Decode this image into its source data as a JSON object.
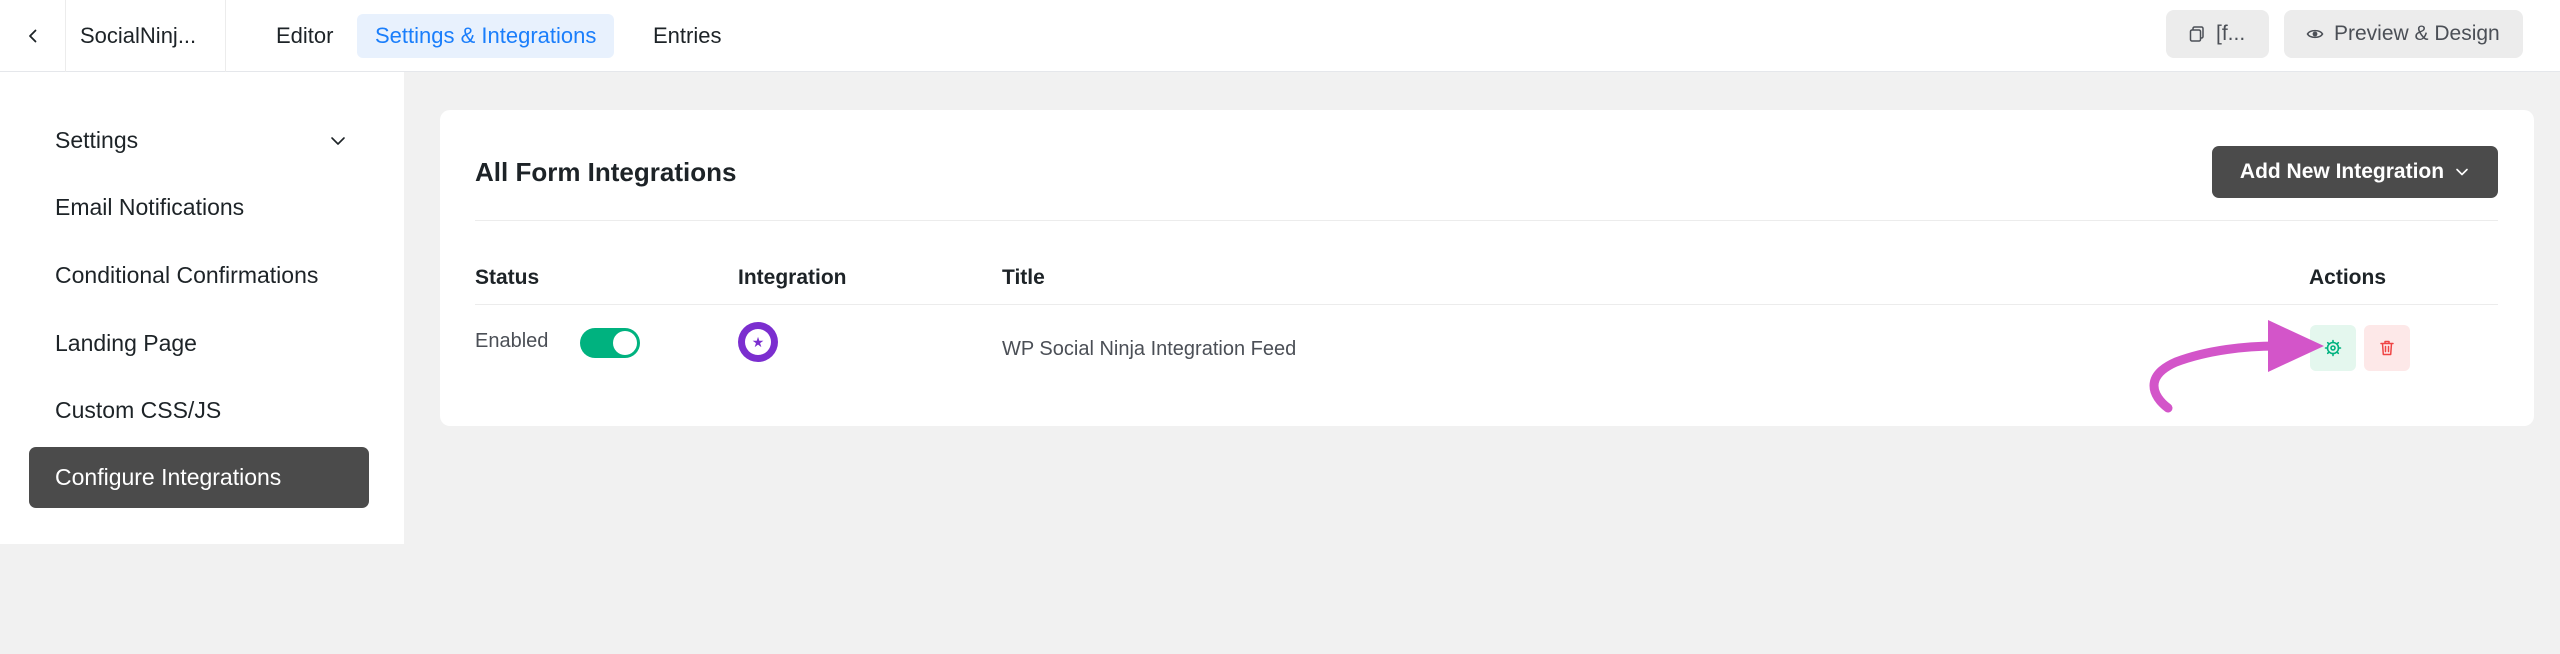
{
  "topbar": {
    "back_icon": "chevron-left-icon",
    "form_name": "SocialNinj...",
    "tabs": [
      {
        "label": "Editor"
      },
      {
        "label": "Settings & Integrations",
        "active": true
      },
      {
        "label": "Entries"
      }
    ],
    "shortcode_label": "[f...",
    "preview_label": "Preview & Design",
    "accent_color": "#1a7efb"
  },
  "sidebar": {
    "items": [
      {
        "label": "Settings",
        "has_chevron": true
      },
      {
        "label": "Email Notifications"
      },
      {
        "label": "Conditional Confirmations"
      },
      {
        "label": "Landing Page"
      },
      {
        "label": "Custom CSS/JS"
      },
      {
        "label": "Configure Integrations",
        "active": true
      }
    ]
  },
  "main": {
    "title": "All Form Integrations",
    "add_button_label": "Add New Integration",
    "columns": [
      "Status",
      "Integration",
      "Title",
      "Actions"
    ],
    "rows": [
      {
        "status_label": "Enabled",
        "enabled": true,
        "integration_icon": "wp-social-ninja-logo-icon",
        "title": "WP Social Ninja Integration Feed",
        "actions": [
          "settings-gear-icon",
          "trash-icon"
        ]
      }
    ],
    "toggle_color": "#00b27f",
    "annotation_arrow_color": "#d355c9"
  }
}
